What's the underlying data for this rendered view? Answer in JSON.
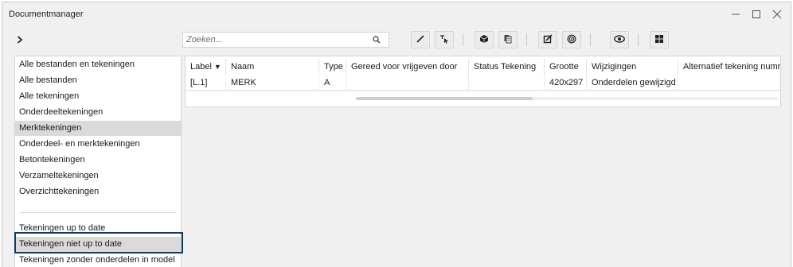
{
  "window": {
    "title": "Documentmanager",
    "controls": {
      "minimize_icon": "minimize-icon",
      "maximize_icon": "maximize-icon",
      "close_icon": "close-icon"
    }
  },
  "toolbar": {
    "expand_icon": "chevron-right-icon",
    "search": {
      "placeholder": "Zoeken...",
      "value": "",
      "icon": "search-icon"
    },
    "buttons": [
      {
        "name": "pencil-icon"
      },
      {
        "name": "select-cursor-icon"
      },
      {
        "name": "cube-icon"
      },
      {
        "name": "document-stack-icon"
      },
      {
        "name": "square-pencil-icon"
      },
      {
        "name": "revision-cloud-icon"
      },
      {
        "name": "eye-icon"
      },
      {
        "name": "grid-icon"
      }
    ]
  },
  "sidebar": {
    "items": [
      {
        "label": "Alle bestanden en tekeningen"
      },
      {
        "label": "Alle bestanden"
      },
      {
        "label": "Alle tekeningen"
      },
      {
        "label": "Onderdeeltekeningen"
      },
      {
        "label": "Merktekeningen",
        "active": true
      },
      {
        "label": "Onderdeel- en merktekeningen"
      },
      {
        "label": "Betontekeningen"
      },
      {
        "label": "Verzameltekeningen"
      },
      {
        "label": "Overzichttekeningen"
      },
      {
        "label": "Tekeningen up to date"
      },
      {
        "label": "Tekeningen niet up to date",
        "highlighted": true
      },
      {
        "label": "Tekeningen zonder onderdelen in model"
      }
    ]
  },
  "table": {
    "columns": [
      "Label",
      "Naam",
      "Type",
      "Gereed voor vrijgeven door",
      "Status Tekening",
      "Grootte",
      "Wijzigingen",
      "Alternatief tekening numme"
    ],
    "sort_indicator": "▼",
    "rows": [
      [
        "[L.1]",
        "MERK",
        "A",
        "",
        "",
        "420x297",
        "Onderdelen gewijzigd",
        ""
      ]
    ]
  },
  "colors": {
    "highlight_border": "#0b3b6a",
    "active_item": "#dadada"
  }
}
